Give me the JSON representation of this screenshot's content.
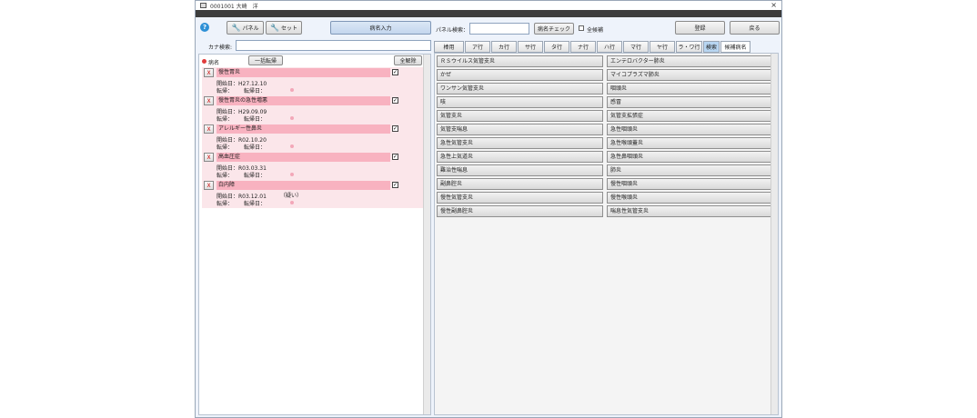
{
  "window": {
    "title": "0001001 大崎　洋",
    "close_label": "×"
  },
  "toolbar": {
    "help_label": "?",
    "panel_label": "パネル",
    "set_label": "セット",
    "disease_input_label": "病名入力",
    "panel_search_label": "パネル検索：",
    "panel_search_value": "",
    "disease_check_label": "病名チェック",
    "all_candidates_label": "全候補",
    "register_label": "登録",
    "back_label": "戻る"
  },
  "kana_search": {
    "label": "カナ検索:",
    "value": ""
  },
  "disease_list": {
    "header_label": "病名",
    "bulk_outcome_label": "一括転帰",
    "clear_all_label": "全解除",
    "x_label": "X",
    "check_mark": "✓",
    "items": [
      {
        "name": "慢性胃炎",
        "start": "開始日：H27.12.10",
        "outcome": "転帰：",
        "outcome_date": "転帰日：",
        "note": ""
      },
      {
        "name": "慢性胃炎の急性増悪",
        "start": "開始日：H29.09.09",
        "outcome": "転帰：",
        "outcome_date": "転帰日：",
        "note": ""
      },
      {
        "name": "アレルギー性鼻炎",
        "start": "開始日：R02.10.20",
        "outcome": "転帰：",
        "outcome_date": "転帰日：",
        "note": ""
      },
      {
        "name": "高血圧症",
        "start": "開始日：R03.03.31",
        "outcome": "転帰：",
        "outcome_date": "転帰日：",
        "note": ""
      },
      {
        "name": "白内障",
        "start": "開始日：R03.12.01",
        "outcome": "転帰：",
        "outcome_date": "転帰日：",
        "note": "（疑い）"
      }
    ]
  },
  "tabs": [
    "棒用",
    "ア行",
    "カ行",
    "サ行",
    "タ行",
    "ナ行",
    "ハ行",
    "マ行",
    "ヤ行",
    "ラ・ワ行",
    "検索",
    "候補病名"
  ],
  "panel_left": [
    "ＲＳウイルス気管支炎",
    "かぜ",
    "ワンサン気管支炎",
    "咳",
    "気管支炎",
    "気管支喘息",
    "急性気管支炎",
    "急性上気道炎",
    "難治性喘息",
    "副鼻腔炎",
    "慢性気管支炎",
    "慢性副鼻腔炎"
  ],
  "panel_right": [
    "エンテロバクター肺炎",
    "マイコプラズマ肺炎",
    "咽頭炎",
    "感冒",
    "気管支拡張症",
    "急性咽頭炎",
    "急性喉頭蓋炎",
    "急性鼻咽頭炎",
    "肺炎",
    "慢性咽頭炎",
    "慢性喉頭炎",
    "喘息性気管支炎"
  ],
  "colors": {
    "accent_blue": "#b8d6f2",
    "pink_row": "#f8b2c0",
    "pink_bg": "#fbe6ea"
  }
}
